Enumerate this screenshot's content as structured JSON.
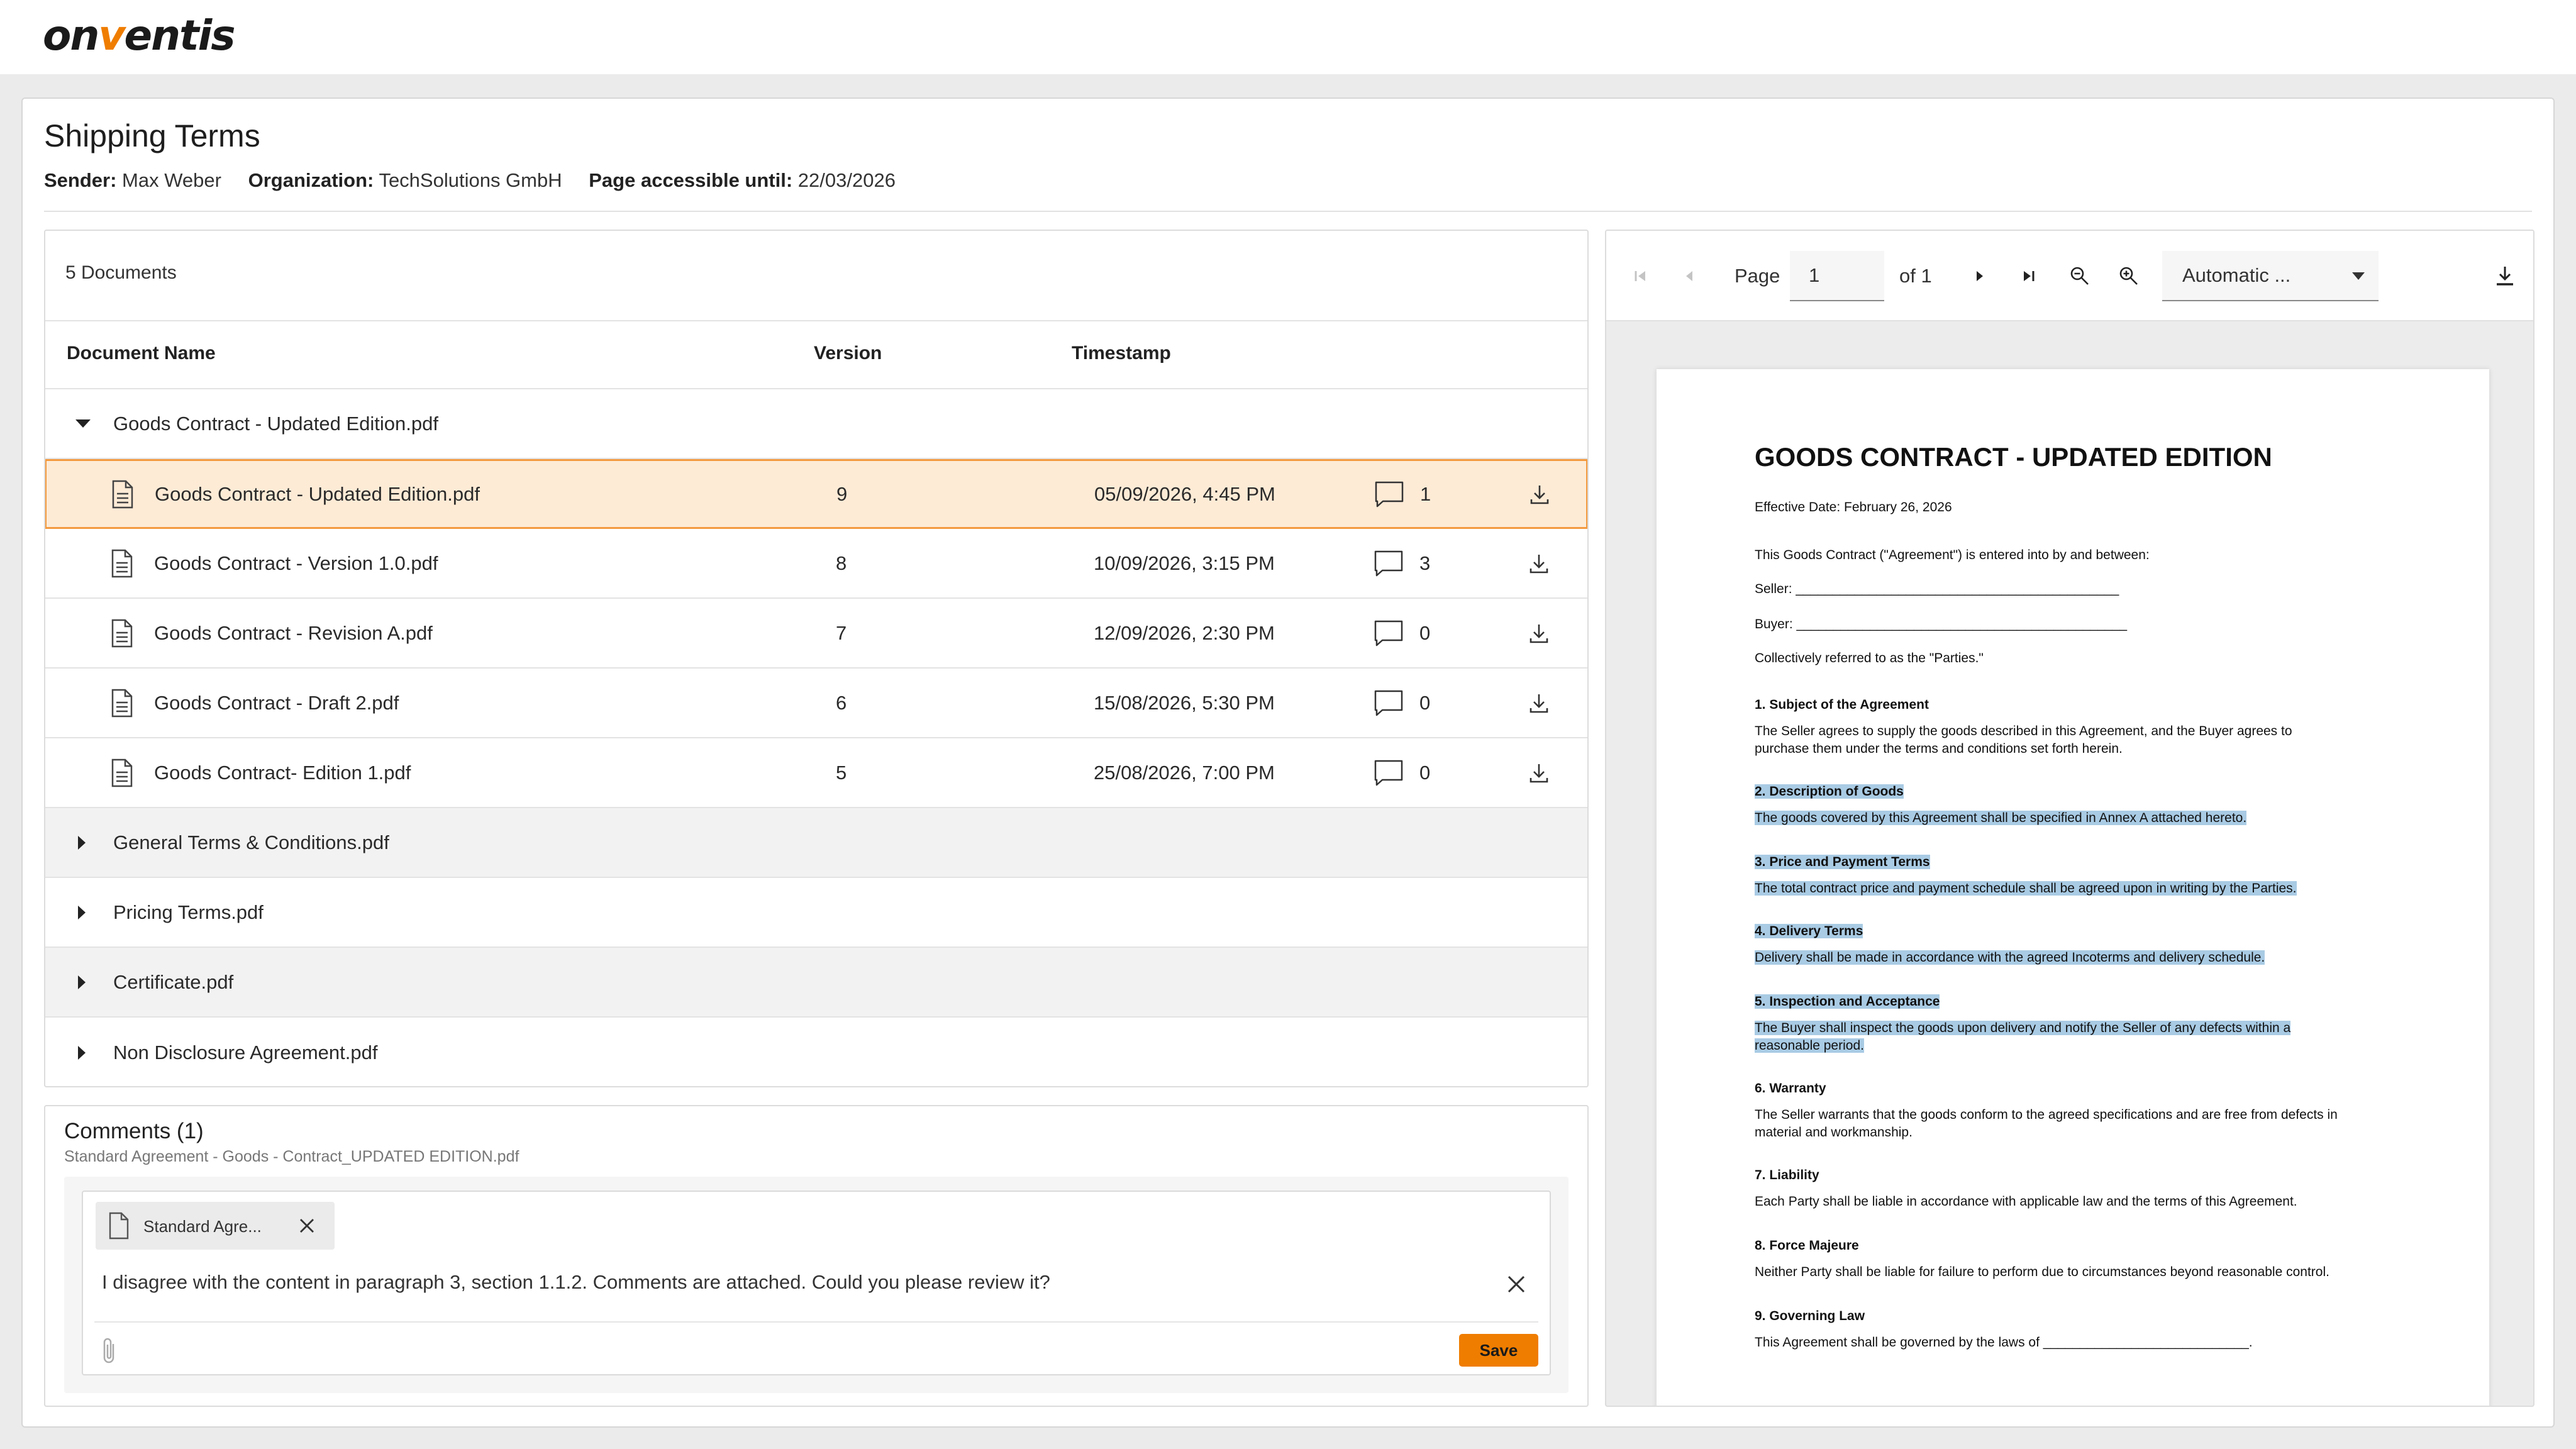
{
  "brand": {
    "logo_prefix": "on",
    "logo_accent": "v",
    "logo_suffix": "entis",
    "accent_color": "#ef7d00"
  },
  "header": {
    "title": "Shipping Terms",
    "sender_label": "Sender:",
    "sender": "Max Weber",
    "org_label": "Organization:",
    "org": "TechSolutions GmbH",
    "accessible_label": "Page accessible until:",
    "accessible": "22/03/2026"
  },
  "documents": {
    "count_label": "5 Documents",
    "columns": {
      "name": "Document Name",
      "version": "Version",
      "timestamp": "Timestamp"
    },
    "expanded_group": "Goods Contract - Updated Edition.pdf",
    "versions": [
      {
        "name": "Goods Contract - Updated Edition.pdf",
        "version": "9",
        "timestamp": "05/09/2026, 4:45 PM",
        "comments": "1",
        "selected": true
      },
      {
        "name": "Goods Contract - Version 1.0.pdf",
        "version": "8",
        "timestamp": "10/09/2026, 3:15 PM",
        "comments": "3"
      },
      {
        "name": "Goods Contract - Revision A.pdf",
        "version": "7",
        "timestamp": "12/09/2026, 2:30 PM",
        "comments": "0"
      },
      {
        "name": "Goods Contract - Draft 2.pdf",
        "version": "6",
        "timestamp": "15/08/2026, 5:30 PM",
        "comments": "0"
      },
      {
        "name": "Goods Contract- Edition 1.pdf",
        "version": "5",
        "timestamp": "25/08/2026, 7:00 PM",
        "comments": "0"
      }
    ],
    "collapsed_groups": [
      "General Terms & Conditions.pdf",
      "Pricing Terms.pdf",
      "Certificate.pdf",
      "Non Disclosure Agreement.pdf"
    ]
  },
  "comments": {
    "title": "Comments (1)",
    "subtitle": "Standard Agreement - Goods - Contract_UPDATED EDITION.pdf",
    "attachment_chip": "Standard Agre...",
    "text": "I disagree with the content in paragraph 3, section 1.1.2. Comments are attached. Could you please review it?",
    "save_label": "Save"
  },
  "viewer": {
    "page_label": "Page",
    "page_value": "1",
    "page_of": "of 1",
    "zoom_value": "Automatic ..."
  },
  "pdf": {
    "title": "GOODS CONTRACT - UPDATED EDITION",
    "effective": "Effective Date: February 26, 2026",
    "intro": "This Goods Contract (\"Agreement\") is entered into by and between:",
    "seller": "Seller: ____________________________________________",
    "buyer": "Buyer: _____________________________________________",
    "parties": "Collectively referred to as the \"Parties.\"",
    "s1_head": "1. Subject of the Agreement",
    "s1_l1": "The Seller agrees to supply the goods described in this Agreement, and the Buyer agrees to",
    "s1_l2": "purchase them under the terms and conditions set forth herein.",
    "s2_head": "2. Description of Goods",
    "s2_l1": "The goods covered by this Agreement shall be specified in Annex A attached hereto.",
    "s3_head": "3. Price and Payment Terms",
    "s3_l1": "The total contract price and payment schedule shall be agreed upon in writing by the Parties.",
    "s4_head": "4. Delivery Terms",
    "s4_l1": "Delivery shall be made in accordance with the agreed Incoterms and delivery schedule.",
    "s5_head": "5. Inspection and Acceptance",
    "s5_l1": "The Buyer shall inspect the goods upon delivery and notify the Seller of any defects within a",
    "s5_l2": "reasonable period.",
    "s6_head": "6. Warranty",
    "s6_l1": "The Seller warrants that the goods conform to the agreed specifications and are free from defects in",
    "s6_l2": "material and workmanship.",
    "s7_head": "7. Liability",
    "s7_l1": "Each Party shall be liable in accordance with applicable law and the terms of this Agreement.",
    "s8_head": "8. Force Majeure",
    "s8_l1": "Neither Party shall be liable for failure to perform due to circumstances beyond reasonable control.",
    "s9_head": "9. Governing Law",
    "s9_l1": "This Agreement shall be governed by the laws of ____________________________."
  }
}
